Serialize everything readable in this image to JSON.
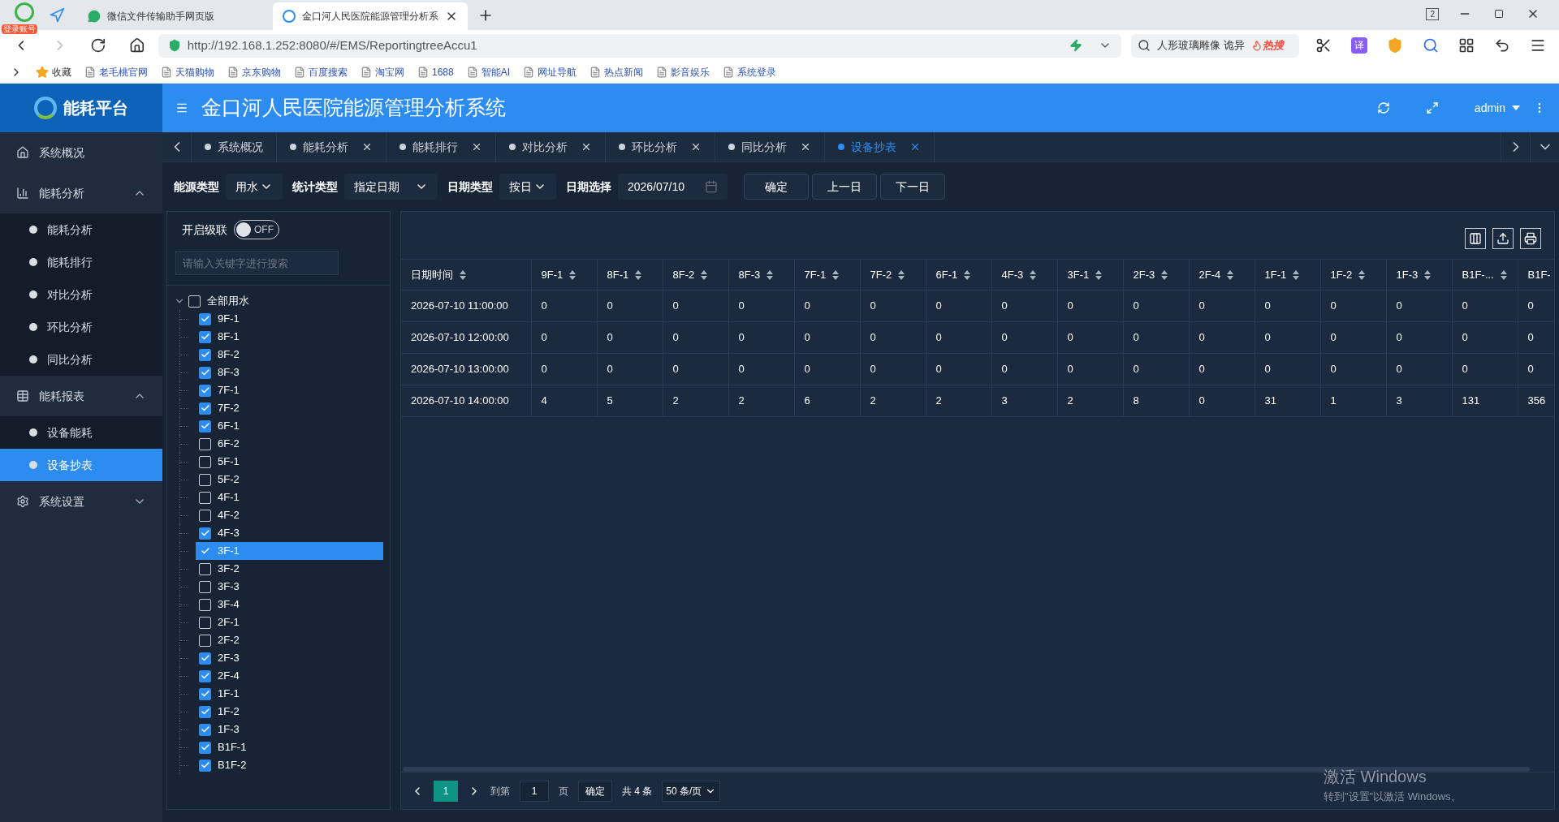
{
  "browser": {
    "login_badge": "登录账号",
    "tabs": [
      {
        "title": "微信文件传输助手网页版",
        "selected": false
      },
      {
        "title": "金口河人民医院能源管理分析系",
        "selected": true
      }
    ],
    "window_count": "2",
    "url": "http://192.168.1.252:8080/#/EMS/ReportingtreeAccu1",
    "search_text": "人形玻璃雕像 诡异",
    "search_badge": "热搜",
    "translate_label": "译",
    "favorites_label": "收藏",
    "bookmarks": [
      "老毛桃官网",
      "天猫购物",
      "京东购物",
      "百度搜索",
      "淘宝网",
      "1688",
      "智能AI",
      "网址导航",
      "热点新闻",
      "影音娱乐",
      "系统登录"
    ]
  },
  "app": {
    "logo": "能耗平台",
    "title": "金口河人民医院能源管理分析系统",
    "user": "admin"
  },
  "sidebar": [
    {
      "label": "系统概况",
      "selected": false
    },
    {
      "label": "能耗分析",
      "expanded": true,
      "children": [
        {
          "label": "能耗分析",
          "selected": false
        },
        {
          "label": "能耗排行",
          "selected": false
        },
        {
          "label": "对比分析",
          "selected": false
        },
        {
          "label": "环比分析",
          "selected": false
        },
        {
          "label": "同比分析",
          "selected": false
        }
      ]
    },
    {
      "label": "能耗报表",
      "expanded": true,
      "children": [
        {
          "label": "设备能耗",
          "selected": false
        },
        {
          "label": "设备抄表",
          "selected": true
        }
      ]
    },
    {
      "label": "系统设置",
      "expanded": false
    }
  ],
  "page_tabs": [
    {
      "label": "系统概况",
      "selected": false,
      "closable": false
    },
    {
      "label": "能耗分析",
      "selected": false,
      "closable": true
    },
    {
      "label": "能耗排行",
      "selected": false,
      "closable": true
    },
    {
      "label": "对比分析",
      "selected": false,
      "closable": true
    },
    {
      "label": "环比分析",
      "selected": false,
      "closable": true
    },
    {
      "label": "同比分析",
      "selected": false,
      "closable": true
    },
    {
      "label": "设备抄表",
      "selected": true,
      "closable": true
    }
  ],
  "filters": [
    {
      "label": "能源类型",
      "value": "用水",
      "kind": "select"
    },
    {
      "label": "统计类型",
      "value": "指定日期",
      "kind": "select"
    },
    {
      "label": "日期类型",
      "value": "按日",
      "kind": "select"
    },
    {
      "label": "日期选择",
      "value": "2026/07/10",
      "kind": "date"
    }
  ],
  "buttons": [
    "确定",
    "上一日",
    "下一日"
  ],
  "cascade": {
    "label": "开启级联",
    "on": false,
    "switch_text": "OFF"
  },
  "search": {
    "placeholder": "请输入关键字进行搜索"
  },
  "tree": {
    "label": "全部用水",
    "checked": false,
    "expanded": true,
    "children": [
      {
        "label": "9F-1",
        "checked": true,
        "selected": false
      },
      {
        "label": "8F-1",
        "checked": true,
        "selected": false
      },
      {
        "label": "8F-2",
        "checked": true,
        "selected": false
      },
      {
        "label": "8F-3",
        "checked": true,
        "selected": false
      },
      {
        "label": "7F-1",
        "checked": true,
        "selected": false
      },
      {
        "label": "7F-2",
        "checked": true,
        "selected": false
      },
      {
        "label": "6F-1",
        "checked": true,
        "selected": false
      },
      {
        "label": "6F-2",
        "checked": false,
        "selected": false
      },
      {
        "label": "5F-1",
        "checked": false,
        "selected": false
      },
      {
        "label": "5F-2",
        "checked": false,
        "selected": false
      },
      {
        "label": "4F-1",
        "checked": false,
        "selected": false
      },
      {
        "label": "4F-2",
        "checked": false,
        "selected": false
      },
      {
        "label": "4F-3",
        "checked": true,
        "selected": false
      },
      {
        "label": "3F-1",
        "checked": true,
        "selected": true
      },
      {
        "label": "3F-2",
        "checked": false,
        "selected": false
      },
      {
        "label": "3F-3",
        "checked": false,
        "selected": false
      },
      {
        "label": "3F-4",
        "checked": false,
        "selected": false
      },
      {
        "label": "2F-1",
        "checked": false,
        "selected": false
      },
      {
        "label": "2F-2",
        "checked": false,
        "selected": false
      },
      {
        "label": "2F-3",
        "checked": true,
        "selected": false
      },
      {
        "label": "2F-4",
        "checked": true,
        "selected": false
      },
      {
        "label": "1F-1",
        "checked": true,
        "selected": false
      },
      {
        "label": "1F-2",
        "checked": true,
        "selected": false
      },
      {
        "label": "1F-3",
        "checked": true,
        "selected": false
      },
      {
        "label": "B1F-1",
        "checked": true,
        "selected": false
      },
      {
        "label": "B1F-2",
        "checked": true,
        "selected": false
      }
    ]
  },
  "table": {
    "columns": [
      {
        "label": "日期时间",
        "sort": true
      },
      {
        "label": "9F-1",
        "sort": true
      },
      {
        "label": "8F-1",
        "sort": true
      },
      {
        "label": "8F-2",
        "sort": true
      },
      {
        "label": "8F-3",
        "sort": true
      },
      {
        "label": "7F-1",
        "sort": true
      },
      {
        "label": "7F-2",
        "sort": true
      },
      {
        "label": "6F-1",
        "sort": true
      },
      {
        "label": "4F-3",
        "sort": true
      },
      {
        "label": "3F-1",
        "sort": true
      },
      {
        "label": "2F-3",
        "sort": true
      },
      {
        "label": "2F-4",
        "sort": true
      },
      {
        "label": "1F-1",
        "sort": true
      },
      {
        "label": "1F-2",
        "sort": true
      },
      {
        "label": "1F-3",
        "sort": true
      },
      {
        "label": "B1F-...",
        "sort": true
      },
      {
        "label": "B1F-",
        "sort": false
      }
    ],
    "rows": [
      [
        "2026-07-10 11:00:00",
        "0",
        "0",
        "0",
        "0",
        "0",
        "0",
        "0",
        "0",
        "0",
        "0",
        "0",
        "0",
        "0",
        "0",
        "0",
        "0"
      ],
      [
        "2026-07-10 12:00:00",
        "0",
        "0",
        "0",
        "0",
        "0",
        "0",
        "0",
        "0",
        "0",
        "0",
        "0",
        "0",
        "0",
        "0",
        "0",
        "0"
      ],
      [
        "2026-07-10 13:00:00",
        "0",
        "0",
        "0",
        "0",
        "0",
        "0",
        "0",
        "0",
        "0",
        "0",
        "0",
        "0",
        "0",
        "0",
        "0",
        "0"
      ],
      [
        "2026-07-10 14:00:00",
        "4",
        "5",
        "2",
        "2",
        "6",
        "2",
        "2",
        "3",
        "2",
        "8",
        "0",
        "31",
        "1",
        "3",
        "131",
        "356"
      ]
    ]
  },
  "pagination": {
    "page": "1",
    "goto_label": "到第",
    "goto_value": "1",
    "page_unit": "页",
    "confirm": "确定",
    "total": "共 4 条",
    "page_size": "50 条/页"
  },
  "os_notice": {
    "title": "激活 Windows",
    "subtitle": "转到\"设置\"以激活 Windows。"
  }
}
